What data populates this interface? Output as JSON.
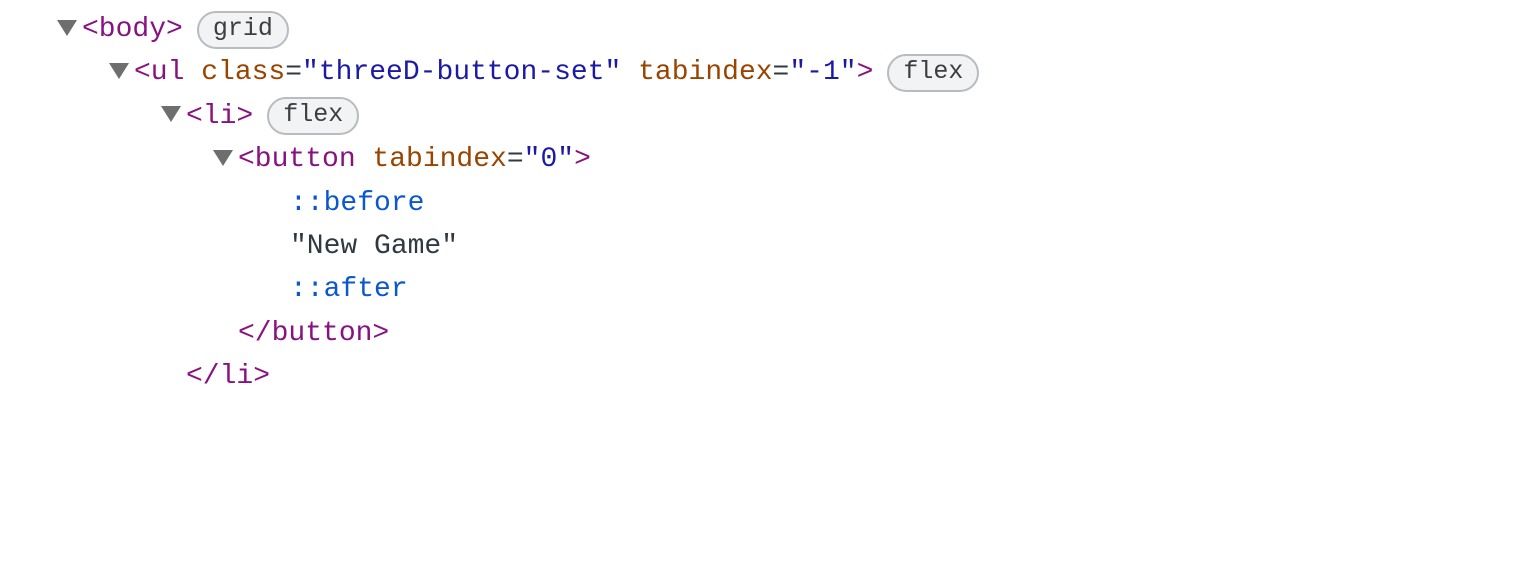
{
  "rows": [
    {
      "indent": 1,
      "arrow": true,
      "parts": [
        {
          "t": "tag",
          "v": "<body>"
        }
      ],
      "badge": "grid",
      "interactable": true,
      "name": "dom-node-body"
    },
    {
      "indent": 2,
      "arrow": true,
      "parts": [
        {
          "t": "tag",
          "v": "<ul "
        },
        {
          "t": "attr-name",
          "v": "class"
        },
        {
          "t": "attr-eq",
          "v": "="
        },
        {
          "t": "attr-val",
          "v": "\"threeD-button-set\""
        },
        {
          "t": "tag",
          "v": " "
        },
        {
          "t": "attr-name",
          "v": "tabindex"
        },
        {
          "t": "attr-eq",
          "v": "="
        },
        {
          "t": "attr-val",
          "v": "\"-1\""
        },
        {
          "t": "tag",
          "v": ">"
        }
      ],
      "badge": "flex",
      "interactable": true,
      "name": "dom-node-ul"
    },
    {
      "indent": 3,
      "arrow": true,
      "parts": [
        {
          "t": "tag",
          "v": "<li>"
        }
      ],
      "badge": "flex",
      "interactable": true,
      "name": "dom-node-li"
    },
    {
      "indent": 4,
      "arrow": true,
      "parts": [
        {
          "t": "tag",
          "v": "<button "
        },
        {
          "t": "attr-name",
          "v": "tabindex"
        },
        {
          "t": "attr-eq",
          "v": "="
        },
        {
          "t": "attr-val",
          "v": "\"0\""
        },
        {
          "t": "tag",
          "v": ">"
        }
      ],
      "badge": null,
      "interactable": true,
      "name": "dom-node-button"
    },
    {
      "indent": 5,
      "arrow": false,
      "parts": [
        {
          "t": "pseudo",
          "v": "::before"
        }
      ],
      "badge": null,
      "interactable": true,
      "name": "dom-pseudo-before"
    },
    {
      "indent": 5,
      "arrow": false,
      "parts": [
        {
          "t": "textnode",
          "v": "\"New Game\""
        }
      ],
      "badge": null,
      "interactable": true,
      "name": "dom-text-node"
    },
    {
      "indent": 5,
      "arrow": false,
      "parts": [
        {
          "t": "pseudo",
          "v": "::after"
        }
      ],
      "badge": null,
      "interactable": true,
      "name": "dom-pseudo-after"
    },
    {
      "indent": 4,
      "arrow": false,
      "parts": [
        {
          "t": "tag",
          "v": "</button>"
        }
      ],
      "badge": null,
      "interactable": true,
      "name": "dom-close-button"
    },
    {
      "indent": 3,
      "arrow": false,
      "parts": [
        {
          "t": "tag",
          "v": "</li>"
        }
      ],
      "badge": null,
      "interactable": true,
      "name": "dom-close-li"
    }
  ]
}
